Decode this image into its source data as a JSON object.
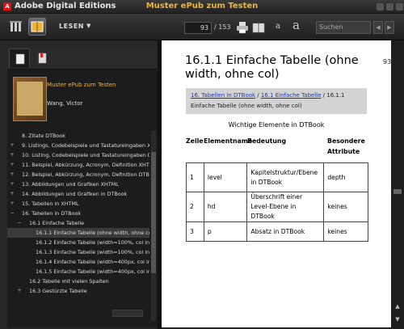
{
  "window": {
    "app_title": "Adobe Digital Editions",
    "document_title": "Muster ePub zum Testen"
  },
  "toolbar": {
    "view_label": "LESEN",
    "page_current": "93",
    "page_total": "/ 153",
    "font_small": "a",
    "font_large": "a",
    "search_placeholder": "Suchen"
  },
  "sidebar": {
    "book_title": "Muster ePub zum Testen",
    "book_author": "Wang, Victor",
    "toc": [
      {
        "label": "8. Zitate DTBook",
        "level": 0,
        "expander": "",
        "selected": false
      },
      {
        "label": "9. Listings, Codebeispiele und Tastatureingaben X",
        "level": 0,
        "expander": "+",
        "selected": false
      },
      {
        "label": "10. Listing, Codebeispiele und Tastatureingaben D",
        "level": 0,
        "expander": "+",
        "selected": false
      },
      {
        "label": "11. Beispiel, Abkürzung, Acronym, Definition XHTM",
        "level": 0,
        "expander": "+",
        "selected": false
      },
      {
        "label": "12. Beispiel, Abkürzung, Acronym, Definition DTBo",
        "level": 0,
        "expander": "+",
        "selected": false
      },
      {
        "label": "13. Abbildungen und Grafiken XHTML",
        "level": 0,
        "expander": "+",
        "selected": false
      },
      {
        "label": "14. Abbildungen und Grafiken in DTBook",
        "level": 0,
        "expander": "+",
        "selected": false
      },
      {
        "label": "15. Tabellen in XHTML",
        "level": 0,
        "expander": "+",
        "selected": false
      },
      {
        "label": "16. Tabellen in DTBook",
        "level": 0,
        "expander": "−",
        "selected": false
      },
      {
        "label": "16.1 Einfache Tabelle",
        "level": 1,
        "expander": "−",
        "selected": false
      },
      {
        "label": "16.1.1 Einfache Tabelle (ohne width, ohne col)",
        "level": 2,
        "expander": "",
        "selected": true
      },
      {
        "label": "16.1.2 Einfache Tabelle (width=100%, col in %)",
        "level": 2,
        "expander": "",
        "selected": false
      },
      {
        "label": "16.1.3 Einfache Tabelle (width=100%, col in Pix",
        "level": 2,
        "expander": "",
        "selected": false
      },
      {
        "label": "16.1.4 Einfache Tabelle (width=400px, col in Pi",
        "level": 2,
        "expander": "",
        "selected": false
      },
      {
        "label": "16.1.5 Einfache Tabelle (width=400px, col in %)",
        "level": 2,
        "expander": "",
        "selected": false
      },
      {
        "label": "16.2 Tabelle mit vielen Spalten",
        "level": 1,
        "expander": "",
        "selected": false
      },
      {
        "label": "16.3 Gestürzte Tabelle",
        "level": 1,
        "expander": "+",
        "selected": false
      }
    ]
  },
  "page": {
    "page_number": "93",
    "heading": "16.1.1 Einfache Tabelle (ohne width, ohne col)",
    "breadcrumb_link1": "16. Tabellen in DTBook",
    "breadcrumb_sep": " / ",
    "breadcrumb_link2": "16.1 Einfache Tabelle",
    "breadcrumb_rest": " / 16.1.1 Einfache Tabelle (ohne width, ohne col)",
    "caption": "Wichtige Elemente in DTBook",
    "table": {
      "headers": [
        "Zeile",
        "Elementname",
        "Bedeutung",
        "Besondere Attribute"
      ],
      "rows": [
        [
          "1",
          "level",
          "Kapitelstruktur/Ebene in DTBook",
          "depth"
        ],
        [
          "2",
          "hd",
          "Überschrift einer Level-Ebene in DTBook",
          "keines"
        ],
        [
          "3",
          "p",
          "Absatz in DTBook",
          "keines"
        ]
      ]
    }
  },
  "colors": {
    "accent": "#f0b43a",
    "link": "#1a3cb8",
    "breadcrumb_bg": "#d3d3d3"
  },
  "icons": [
    "library-icon",
    "reading-view-icon",
    "dropdown-arrow-icon",
    "print-icon",
    "book-icon",
    "bookmarks-tab-icon",
    "toc-tab-icon",
    "prev-page-icon",
    "next-page-icon",
    "scroll-up-icon",
    "scroll-down-icon"
  ]
}
